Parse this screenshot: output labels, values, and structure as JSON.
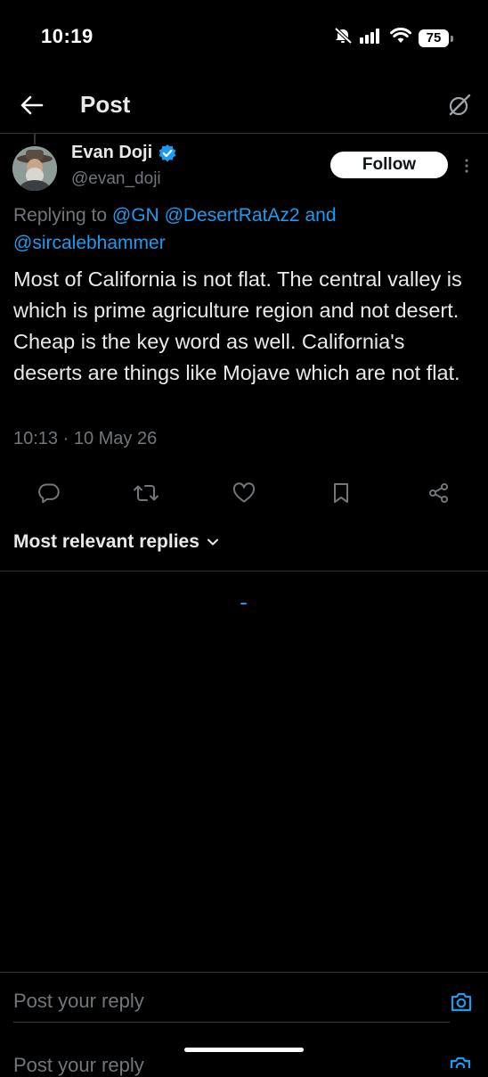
{
  "status_bar": {
    "time": "10:19",
    "battery": "75"
  },
  "header": {
    "title": "Post"
  },
  "tweet": {
    "author_name": "Evan Doji",
    "author_handle": "@evan_doji",
    "follow_label": "Follow",
    "reply_prefix": "Replying to ",
    "mentions": [
      "@GN",
      "@DesertRatAz2",
      "@sircalebhammer"
    ],
    "reply_and": "and",
    "text": "Most of California is not flat. The central valley is which is prime agriculture region and not desert. Cheap is the key word as well. California's deserts are things like Mojave which are not flat.",
    "timestamp": "10:13 · 10 May 26"
  },
  "replies": {
    "sort_label": "Most relevant replies"
  },
  "composer": {
    "placeholder": "Post your reply"
  },
  "colors": {
    "accent": "#1d9bf0",
    "background": "#000000",
    "text_primary": "#e7e9ea",
    "text_secondary": "#71767b",
    "divider": "#2f3336"
  },
  "icons": {
    "back": "arrow-left-icon",
    "grok": "grok-icon",
    "verified": "verified-badge-icon",
    "more": "more-vertical-icon",
    "reply": "reply-icon",
    "repost": "repost-icon",
    "like": "like-icon",
    "bookmark": "bookmark-icon",
    "share": "share-icon",
    "chevron": "chevron-down-icon",
    "camera": "camera-icon"
  }
}
